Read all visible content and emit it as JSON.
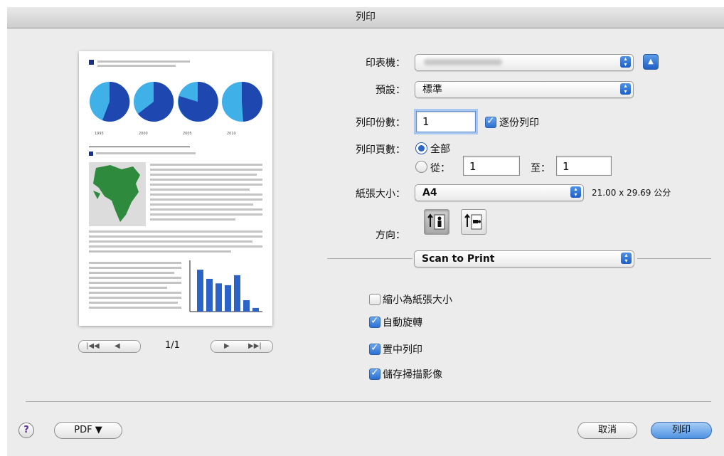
{
  "window": {
    "title": "列印"
  },
  "preview": {
    "page_indicator": "1/1",
    "pie_years": [
      "1995",
      "2000",
      "2005",
      "2010"
    ],
    "bar_values": [
      0.92,
      0.72,
      0.62,
      0.58,
      0.8,
      0.25,
      0.08
    ]
  },
  "printer": {
    "label": "印表機：",
    "value": ""
  },
  "presets": {
    "label": "預設：",
    "value": "標準"
  },
  "copies": {
    "label": "列印份數：",
    "value": "1",
    "collate_label": "逐份列印",
    "collate_checked": true
  },
  "pages": {
    "label": "列印頁數：",
    "all_label": "全部",
    "from_label": "從：",
    "from_value": "1",
    "to_label": "至：",
    "to_value": "1",
    "selected": "all"
  },
  "paper_size": {
    "label": "紙張大小：",
    "value": "A4",
    "dimensions": "21.00 x 29.69 公分"
  },
  "orientation": {
    "label": "方向：",
    "selected": "portrait"
  },
  "panel": {
    "value": "Scan to Print"
  },
  "options": [
    {
      "label": "縮小為紙張大小",
      "checked": false
    },
    {
      "label": "自動旋轉",
      "checked": true
    },
    {
      "label": "置中列印",
      "checked": true
    },
    {
      "label": "儲存掃描影像",
      "checked": true
    }
  ],
  "footer": {
    "help_symbol": "?",
    "pdf_label": "PDF ▼",
    "cancel_label": "取消",
    "print_label": "列印"
  },
  "colors": {
    "accent": "#2a66c6",
    "pie_light": "#3fb0e8",
    "pie_dark": "#1f47b0",
    "bars": "#2b63c8",
    "map_land": "#2e8a3c",
    "map_sea": "#dcdcdc"
  }
}
